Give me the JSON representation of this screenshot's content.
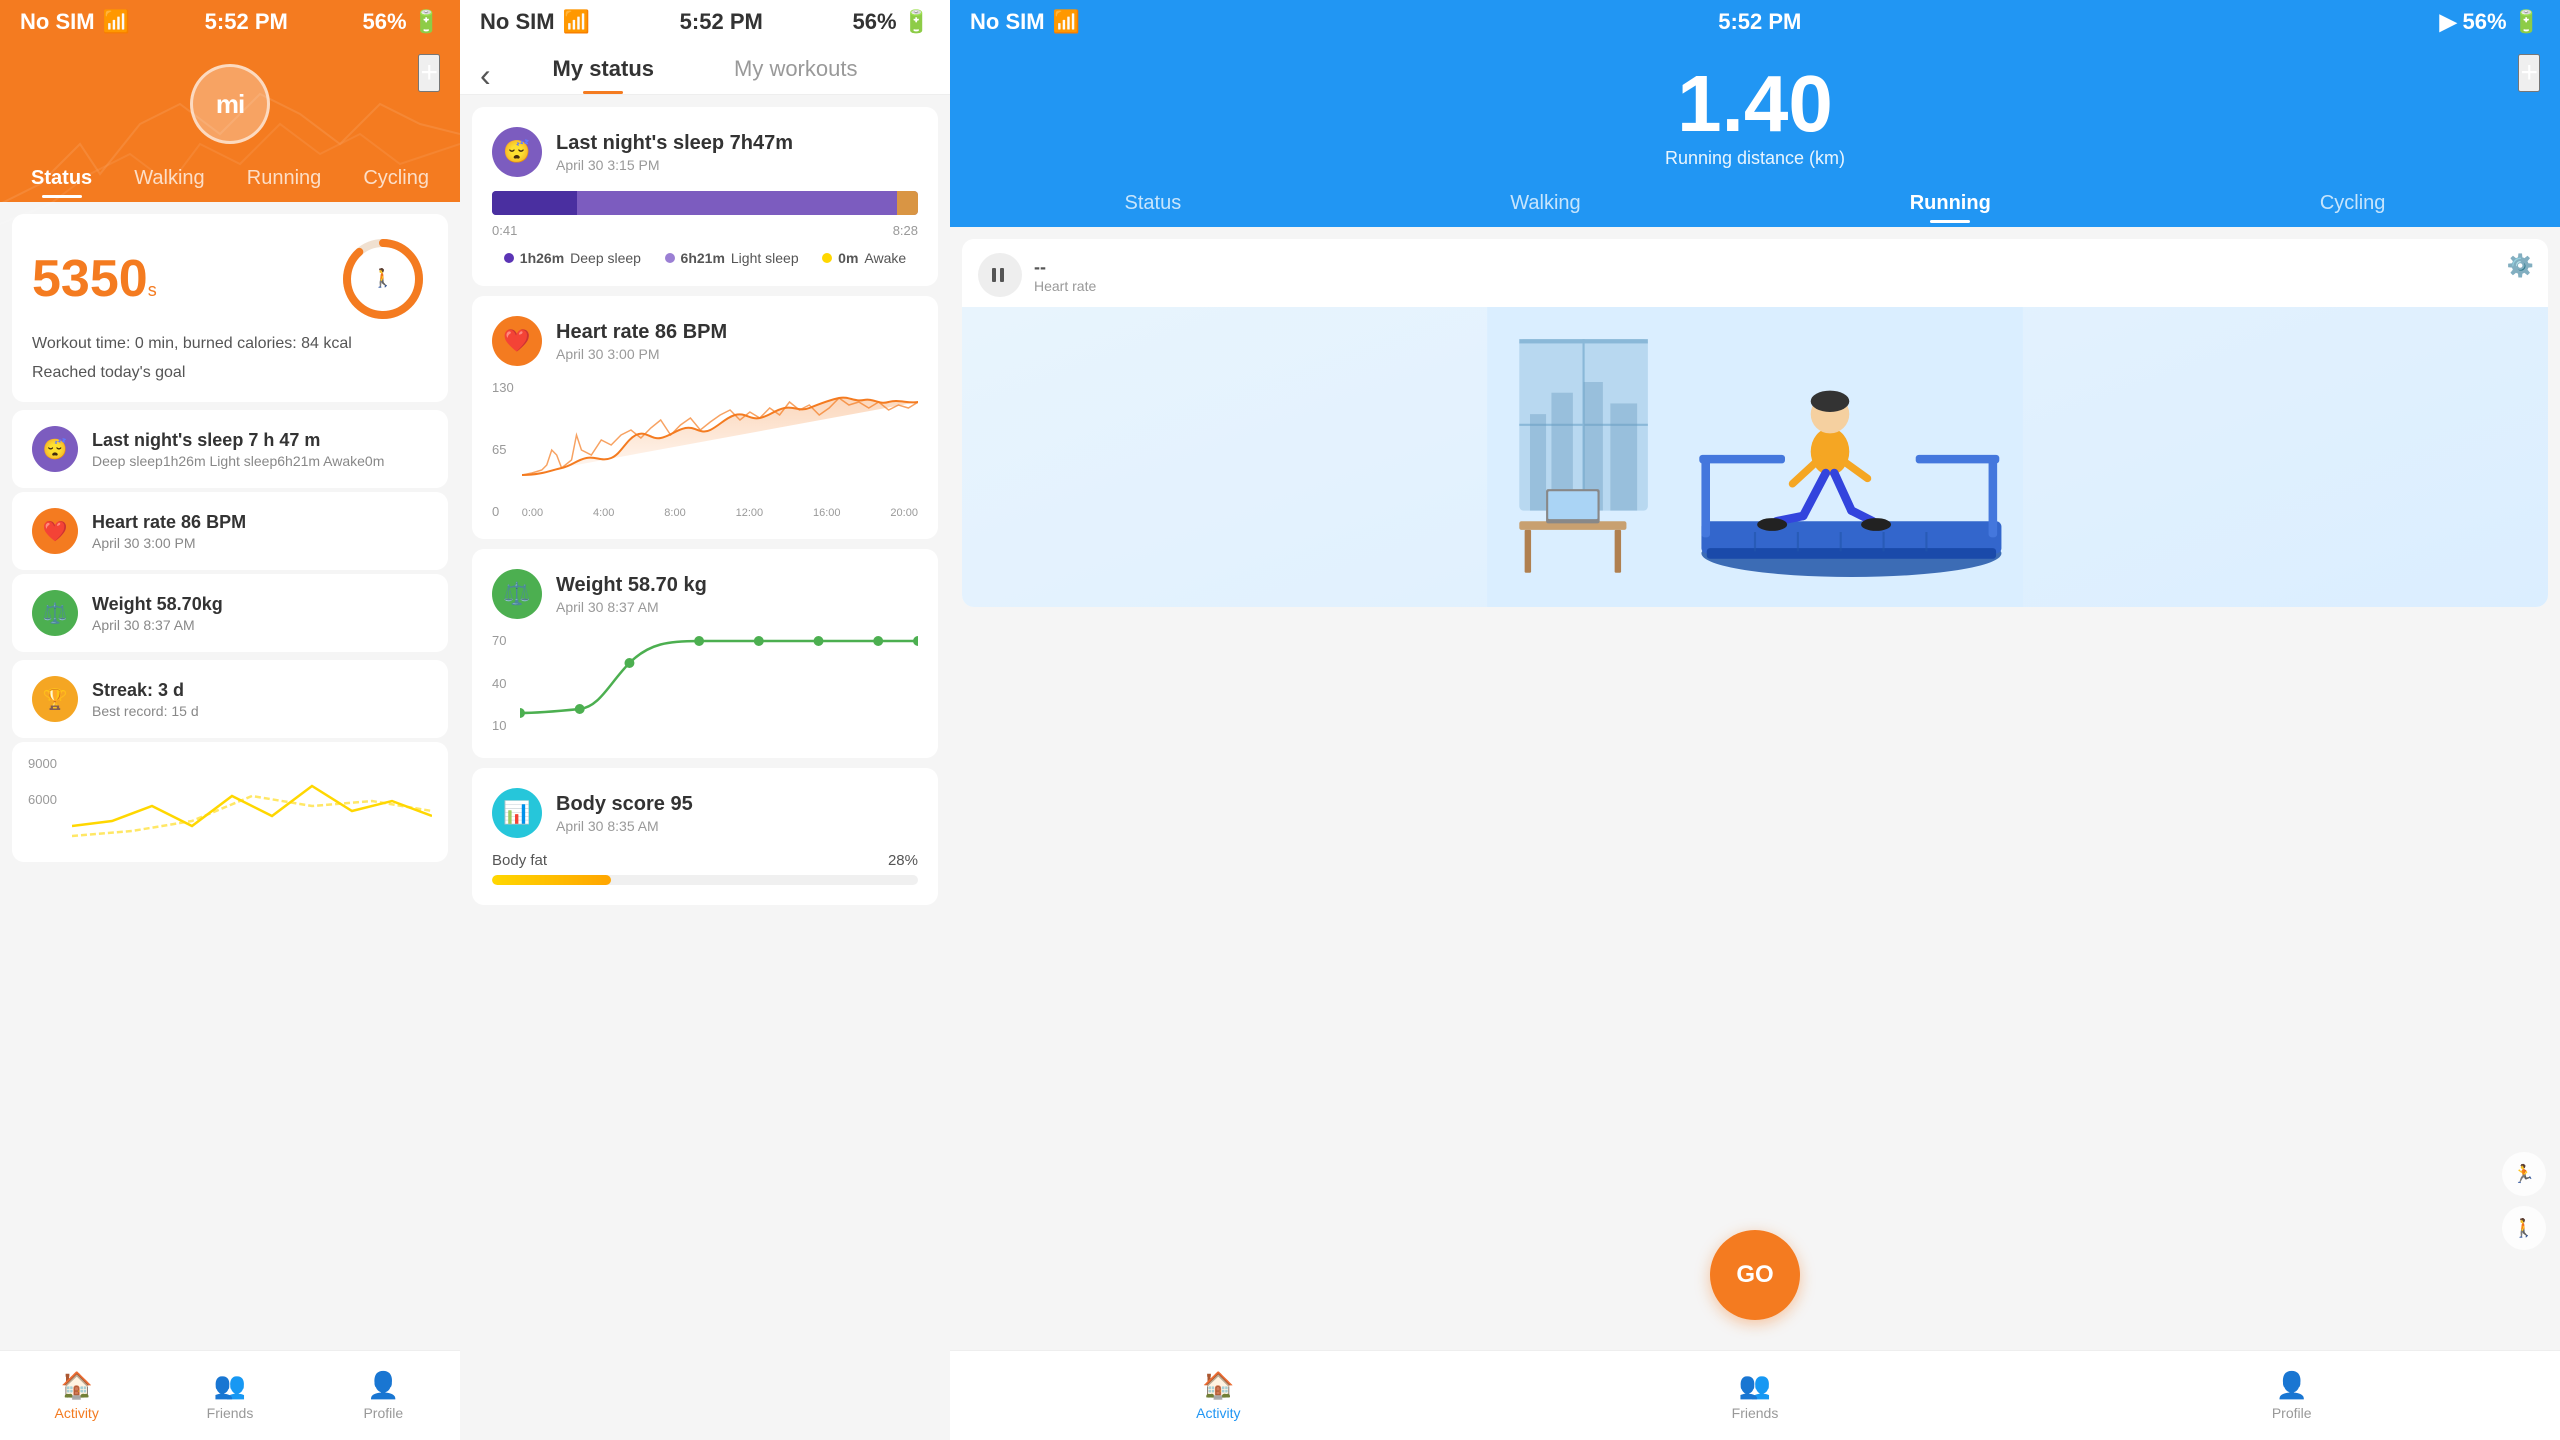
{
  "panel1": {
    "statusBar": {
      "left": "No SIM",
      "center": "5:52 PM",
      "rightBattery": "56%"
    },
    "addButton": "+",
    "miLogo": "mi",
    "tabs": [
      {
        "label": "Status",
        "active": true
      },
      {
        "label": "Walking",
        "active": false
      },
      {
        "label": "Running",
        "active": false
      },
      {
        "label": "Cycling",
        "active": false
      }
    ],
    "steps": {
      "value": "5350",
      "unit": "s",
      "workoutInfo": "Workout time: 0 min, burned calories: 84 kcal",
      "goalText": "Reached today's goal"
    },
    "activities": [
      {
        "iconColor": "purple",
        "iconSymbol": "🕐",
        "title": "Last night's sleep 7 h 47 m",
        "subtitle": "Deep sleep1h26m Light sleep6h21m Awake0m"
      },
      {
        "iconColor": "orange",
        "iconSymbol": "❤️",
        "title": "Heart rate 86 BPM",
        "subtitle": "April 30 3:00 PM"
      },
      {
        "iconColor": "green",
        "iconSymbol": "⚖️",
        "title": "Weight 58.70kg",
        "subtitle": "April 30 8:37 AM"
      }
    ],
    "streak": {
      "iconSymbol": "🏆",
      "title": "Streak: 3 d",
      "subtitle": "Best record: 15 d"
    },
    "chartYLabels": [
      "9000",
      "6000"
    ],
    "bottomNav": {
      "items": [
        {
          "label": "Activity",
          "active": true,
          "icon": "🏠"
        },
        {
          "label": "Friends",
          "active": false,
          "icon": "👤"
        },
        {
          "label": "Profile",
          "active": false,
          "icon": "👤"
        }
      ]
    }
  },
  "panel2": {
    "statusBar": {
      "left": "No SIM",
      "center": "5:52 PM",
      "rightBattery": "56%"
    },
    "backButton": "‹",
    "tabs": [
      {
        "label": "My status",
        "active": true
      },
      {
        "label": "My workouts",
        "active": false
      }
    ],
    "cards": [
      {
        "type": "sleep",
        "iconColor": "purple",
        "iconSymbol": "🕐",
        "title": "Last night's sleep 7h47m",
        "date": "April 30 3:15 PM",
        "timeStart": "0:41",
        "timeEnd": "8:28",
        "deepSleep": "1h26m",
        "lightSleep": "6h21m",
        "awake": "0m"
      },
      {
        "type": "heartrate",
        "iconColor": "orange",
        "iconSymbol": "❤️",
        "title": "Heart rate 86  BPM",
        "date": "April 30 3:00 PM",
        "yLabels": [
          "130",
          "65",
          "0"
        ],
        "xLabels": [
          "0:00",
          "4:00",
          "8:00",
          "12:00",
          "16:00",
          "20:00"
        ]
      },
      {
        "type": "weight",
        "iconColor": "green",
        "iconSymbol": "⚖️",
        "title": "Weight 58.70 kg",
        "date": "April 30 8:37 AM",
        "yLabels": [
          "70",
          "40",
          "10"
        ]
      },
      {
        "type": "bodyscore",
        "iconColor": "teal",
        "iconSymbol": "📊",
        "title": "Body score 95",
        "date": "April 30 8:35 AM",
        "bodyFatLabel": "Body fat",
        "bodyFatValue": "28%",
        "bodyFatFill": 28
      }
    ]
  },
  "panel3": {
    "statusBar": {
      "left": "No SIM",
      "center": "5:52 PM",
      "rightBattery": "56%"
    },
    "addButton": "+",
    "runningDistance": {
      "value": "1.40",
      "label": "Running distance (km)"
    },
    "tabs": [
      {
        "label": "Status",
        "active": false
      },
      {
        "label": "Walking",
        "active": false
      },
      {
        "label": "Running",
        "active": true
      },
      {
        "label": "Cycling",
        "active": false
      }
    ],
    "heartRate": {
      "value": "--",
      "label": "Heart rate"
    },
    "goButton": "GO",
    "bottomNav": {
      "items": [
        {
          "label": "Activity",
          "active": true,
          "icon": "🏠"
        },
        {
          "label": "Friends",
          "active": false,
          "icon": "👤"
        },
        {
          "label": "Profile",
          "active": false,
          "icon": "👤"
        }
      ]
    }
  }
}
